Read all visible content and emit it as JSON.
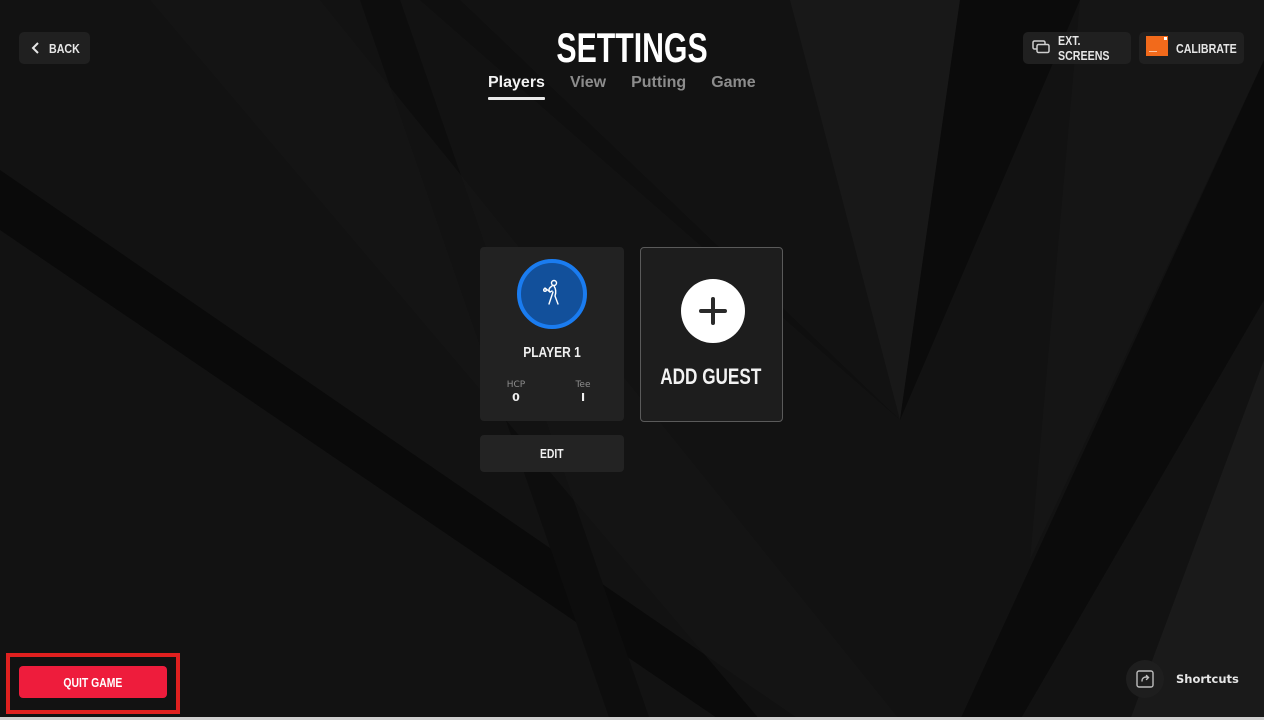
{
  "header": {
    "title": "SETTINGS",
    "back_label": "BACK",
    "ext_screens_label": "EXT. SCREENS",
    "calibrate_label": "CALIBRATE"
  },
  "tabs": [
    {
      "label": "Players",
      "active": true
    },
    {
      "label": "View",
      "active": false
    },
    {
      "label": "Putting",
      "active": false
    },
    {
      "label": "Game",
      "active": false
    }
  ],
  "players": [
    {
      "name": "PLAYER 1",
      "icon": "golfer-icon",
      "stats": [
        {
          "label": "HCP",
          "value": "0"
        },
        {
          "label": "Tee",
          "value": "I"
        }
      ],
      "edit_label": "EDIT"
    }
  ],
  "add_guest": {
    "label": "ADD GUEST",
    "icon": "plus-icon"
  },
  "footer": {
    "quit_label": "QUIT GAME",
    "shortcuts_label": "Shortcuts"
  },
  "colors": {
    "background": "#121212",
    "accent_blue": "#1a7cf0",
    "avatar_fill": "#12509b",
    "quit_red": "#ee1c3c",
    "highlight_red": "#e0201f",
    "calibrate_orange": "#f26a1b"
  }
}
